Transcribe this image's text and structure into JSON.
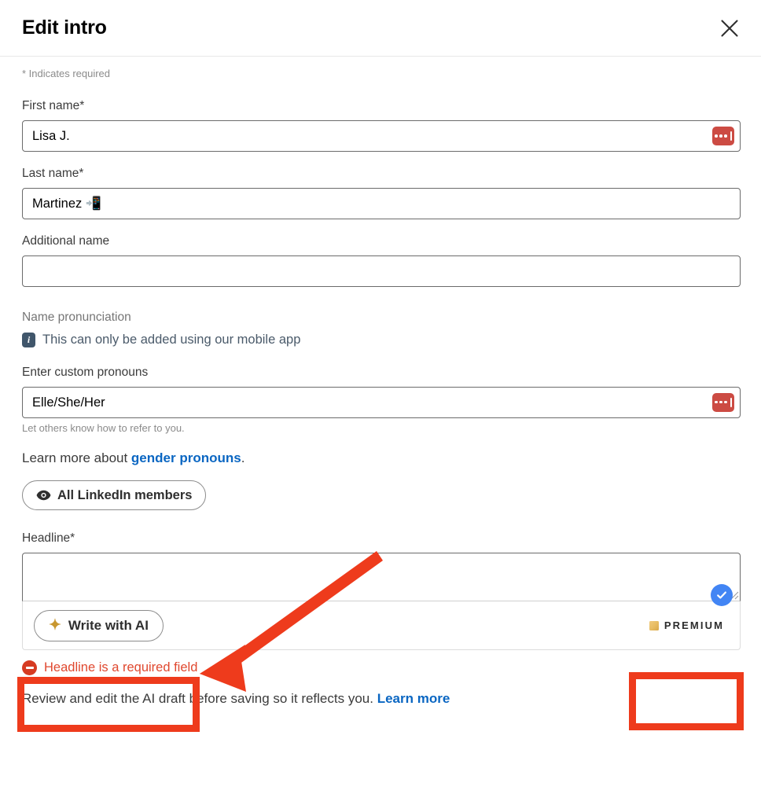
{
  "header": {
    "title": "Edit intro",
    "close_label": "Dismiss",
    "close_icon": "close-icon"
  },
  "form": {
    "required_note": "* Indicates required",
    "first_name": {
      "label": "First name*",
      "value": "Lisa J.",
      "placeholder": "",
      "icon": "password-manager-icon"
    },
    "last_name": {
      "label": "Last name*",
      "value": "Martinez 📲",
      "placeholder": ""
    },
    "additional_name": {
      "label": "Additional name",
      "value": "",
      "placeholder": ""
    },
    "name_pronunciation": {
      "label": "Name pronunciation",
      "note": "This can only be added using our mobile app",
      "note_icon": "info-icon",
      "note_icon_glyph": "i"
    },
    "pronouns": {
      "label": "Enter custom pronouns",
      "value": "Elle/She/Her",
      "placeholder": "",
      "helper": "Let others know how to refer to you.",
      "icon": "password-manager-icon"
    },
    "learn_more_pronouns": {
      "prefix": "Learn more about ",
      "link": "gender pronouns",
      "suffix": "."
    },
    "visibility": {
      "label": "All LinkedIn members",
      "icon": "eye-icon"
    },
    "headline": {
      "label": "Headline*",
      "value": "",
      "placeholder": "",
      "ai_button": {
        "label": "Write with AI",
        "icon": "sparkle-icon",
        "icon_glyph": "✦"
      },
      "premium_badge": {
        "label": "PREMIUM",
        "icon": "premium-square-icon"
      },
      "check_icon": "blue-check-icon",
      "resize_icon": "resize-grip-icon",
      "error": {
        "icon": "error-icon",
        "message": "Headline is a required field"
      },
      "footer_note": {
        "text": "Review and edit the AI draft before saving so it reflects you. ",
        "link": "Learn more"
      }
    }
  },
  "annotations": {
    "ai_button_highlight": "Write with AI button highlight",
    "premium_highlight": "PREMIUM badge highlight",
    "arrow": "arrow pointing to Write with AI button",
    "color": "#ee3b1c"
  },
  "colors": {
    "accent_link": "#0a66c2",
    "annotation_red": "#ee3b1c",
    "error_red": "#d63b22",
    "premium_gold": "#e8bd64",
    "check_blue": "#4285f4",
    "pwm_red": "#cc4b43"
  }
}
